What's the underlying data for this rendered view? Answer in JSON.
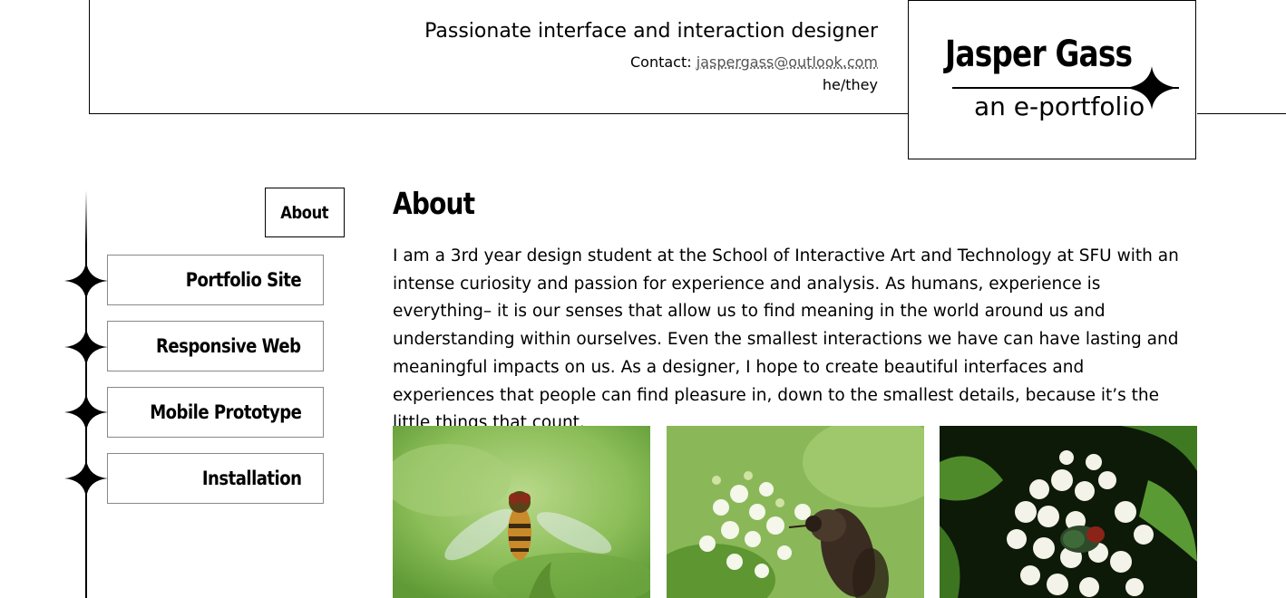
{
  "header": {
    "tagline": "Passionate interface and interaction designer",
    "contact_label": "Contact:",
    "contact_email": "jaspergass@outlook.com",
    "pronouns": "he/they"
  },
  "logo": {
    "name": "Jasper Gass",
    "subtitle": "an e-portfolio"
  },
  "nav": {
    "active": "About",
    "items": [
      {
        "label": "Portfolio Site"
      },
      {
        "label": "Responsive Web"
      },
      {
        "label": "Mobile Prototype"
      },
      {
        "label": "Installation"
      }
    ]
  },
  "main": {
    "title": "About",
    "body": "I am a 3rd year design student at the School of Interactive Art and Technology at SFU with an intense curiosity and passion for experience and analysis. As humans, experience is everything– it is our senses that allow us to find meaning in the world around us and understanding within ourselves. Even the smallest interactions we have can have lasting and meaningful impacts on us. As a designer, I hope to create beautiful interfaces and experiences that people can find pleasure in, down to the smallest details, because it’s the little things that count."
  },
  "photos": [
    {
      "subject": "hoverfly-in-flight",
      "bg": "#8fbf5a"
    },
    {
      "subject": "bee-fly-on-white-flowers",
      "bg": "#7fae4a"
    },
    {
      "subject": "fly-on-white-blossoms",
      "bg": "#0d1a08"
    }
  ]
}
